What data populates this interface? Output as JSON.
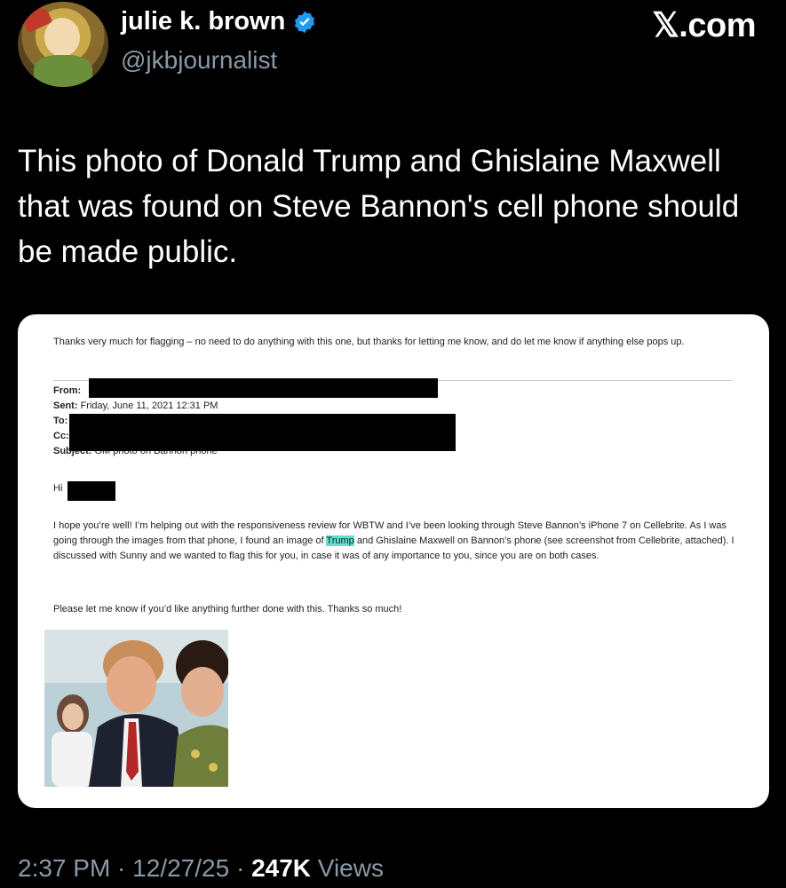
{
  "author": {
    "name": "julie k. brown",
    "handle": "@jkbjournalist",
    "verified": true,
    "avatar_icon": "profile-photo-icon"
  },
  "brand": {
    "logo_text": "𝕏.com"
  },
  "tweet": {
    "text": "This photo of Donald Trump and Ghislaine Maxwell that was found on Steve Bannon's cell phone should be made public."
  },
  "email": {
    "intro": "Thanks very much for flagging – no need to do anything with this one, but thanks for letting me know, and do let me know if anything else pops up.",
    "from_label": "From:",
    "sent_label": "Sent:",
    "sent_value": "Friday, June 11, 2021 12:31 PM",
    "to_label": "To:",
    "cc_label": "Cc:",
    "subject_label": "Subject:",
    "subject_value": "GM photo on Bannon phone",
    "greeting": "Hi",
    "body_before": "I hope you’re well! I’m helping out with the responsiveness review for WBTW and I’ve been looking through Steve Bannon’s iPhone 7 on Cellebrite. As I was going through the images from that phone, I found an image of ",
    "body_highlight": "Trump",
    "body_after": " and Ghislaine Maxwell on Bannon’s phone (see screenshot from Cellebrite, attached). I discussed with Sunny and we wanted to flag this for you, in case it was of any importance to you, since you are on both cases.",
    "closing": "Please let me know if you’d like anything further done with this. Thanks so much!",
    "highlight_color": "#5fe0d0"
  },
  "meta": {
    "time": "2:37 PM",
    "date": "12/27/25",
    "views_count": "247K",
    "views_label": "Views"
  },
  "colors": {
    "background": "#000000",
    "muted": "#8b98a5",
    "verified": "#1d9bf0"
  }
}
